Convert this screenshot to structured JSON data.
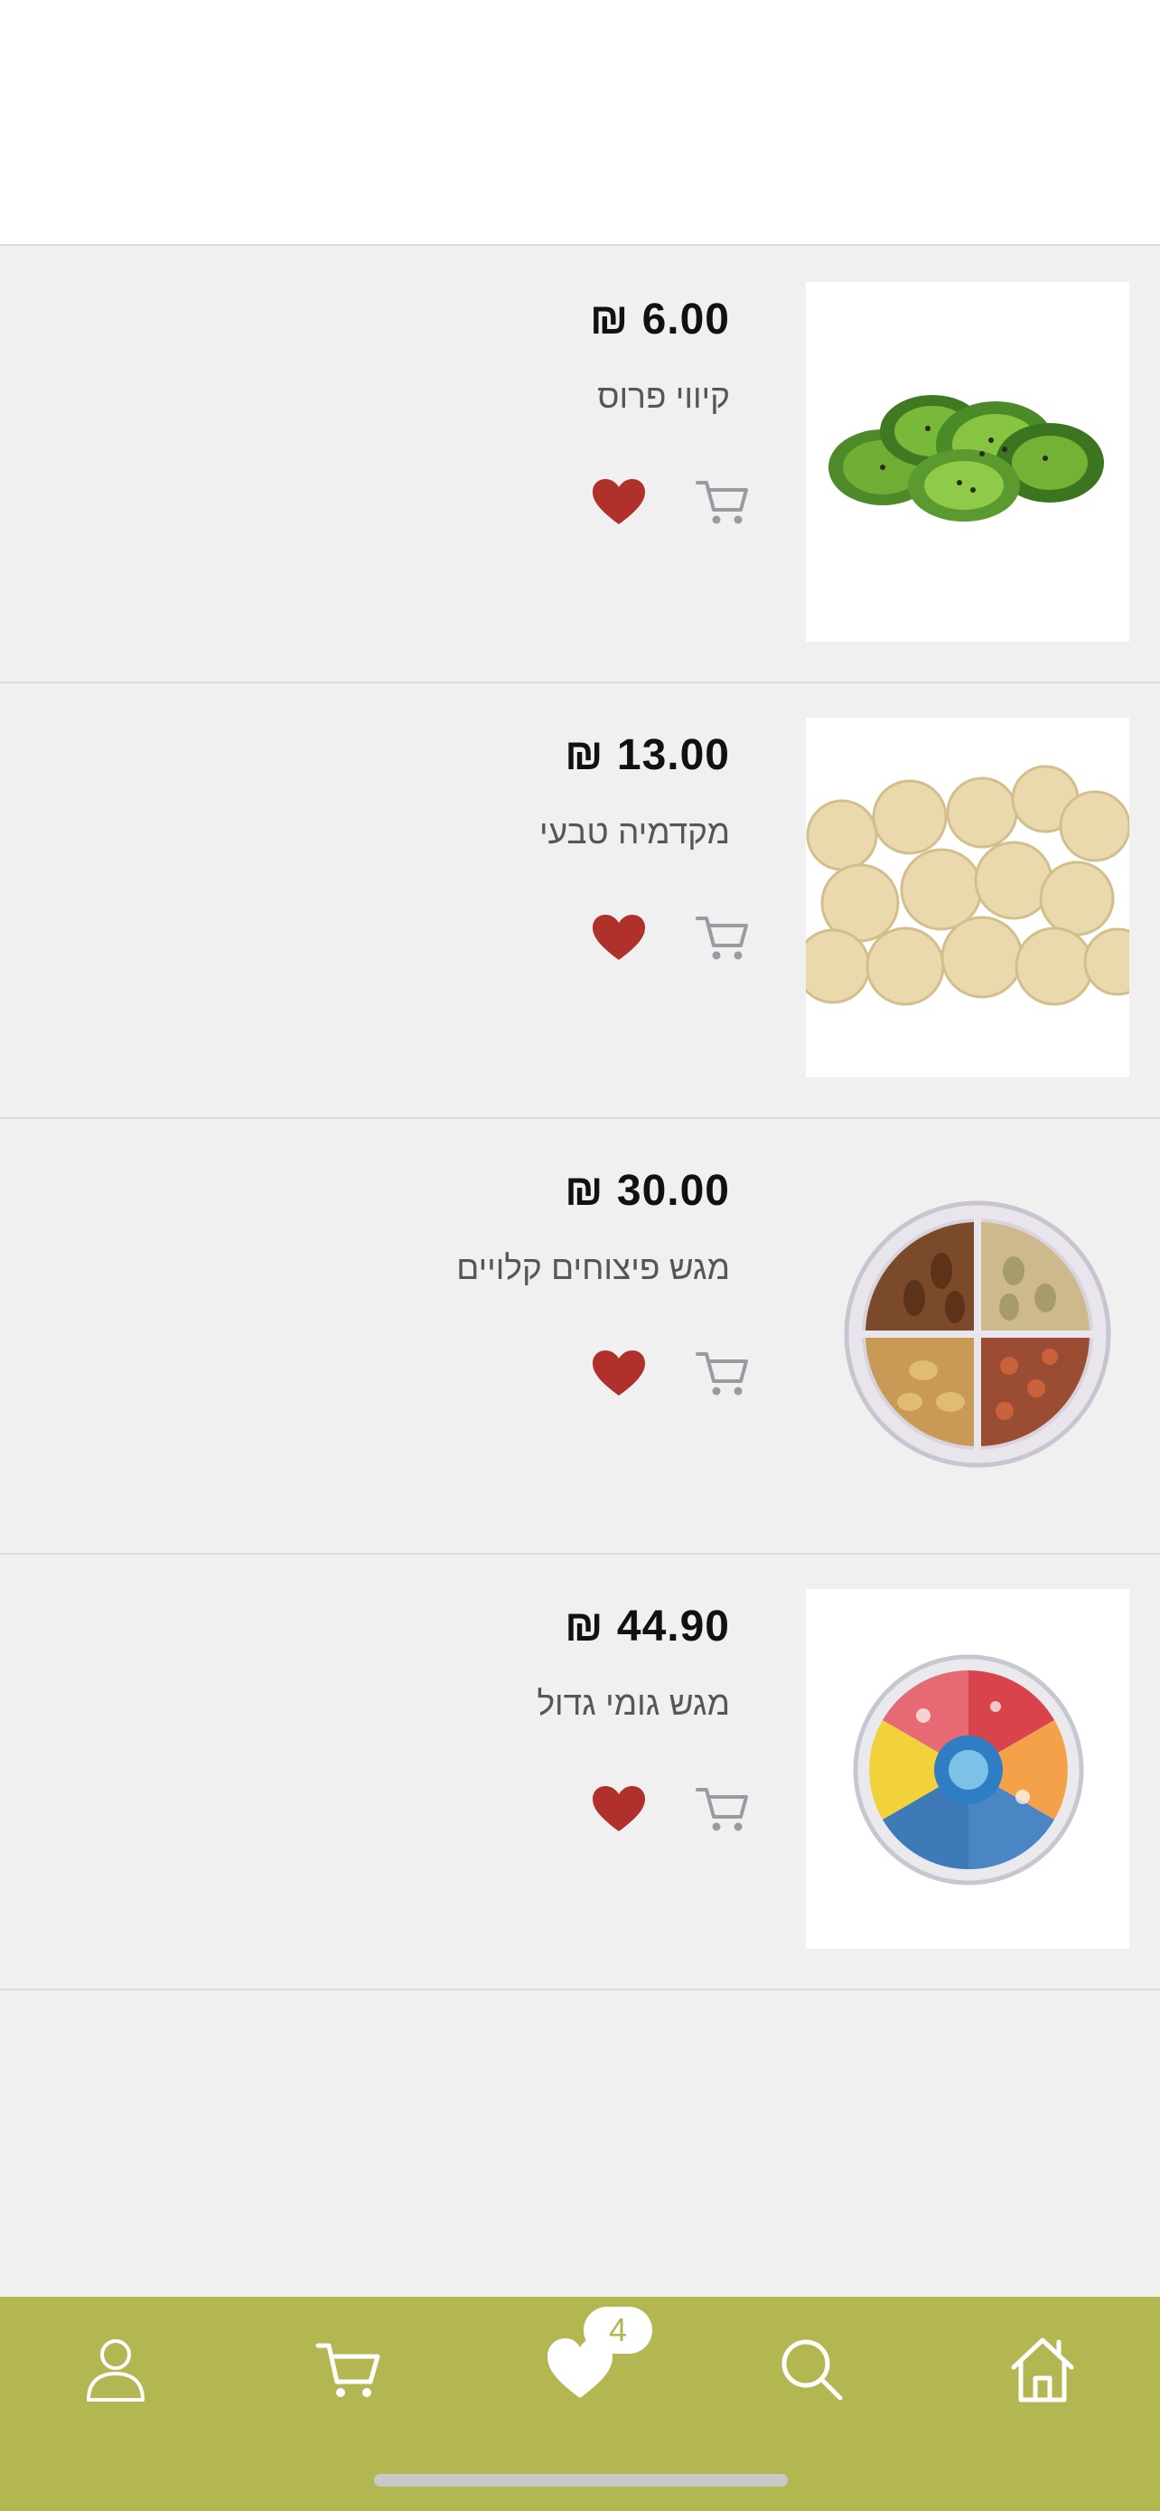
{
  "products": [
    {
      "price": "₪ 6.00",
      "name": "קיווי פרוס",
      "image": "sliced-kiwi",
      "favorite": true
    },
    {
      "price": "₪ 13.00",
      "name": "מקדמיה טבעי",
      "image": "macadamia-nuts",
      "favorite": true
    },
    {
      "price": "₪ 30.00",
      "name": "מגש פיצוחים קלויים",
      "image": "roasted-nuts-tray",
      "favorite": true
    },
    {
      "price": "₪ 44.90",
      "name": "מגש גומי גדול",
      "image": "gummy-candy-tray",
      "favorite": true
    }
  ],
  "tab_bar": {
    "tabs": [
      "profile-icon",
      "cart-icon",
      "favorites-icon",
      "search-icon",
      "home-icon"
    ],
    "favorites_count": "4"
  },
  "colors": {
    "accent": "#b3b752",
    "heart": "#b0312b",
    "cart_icon": "#9a9aa2",
    "price": "#111111",
    "name": "#55555a",
    "background": "#f1f0f1"
  }
}
